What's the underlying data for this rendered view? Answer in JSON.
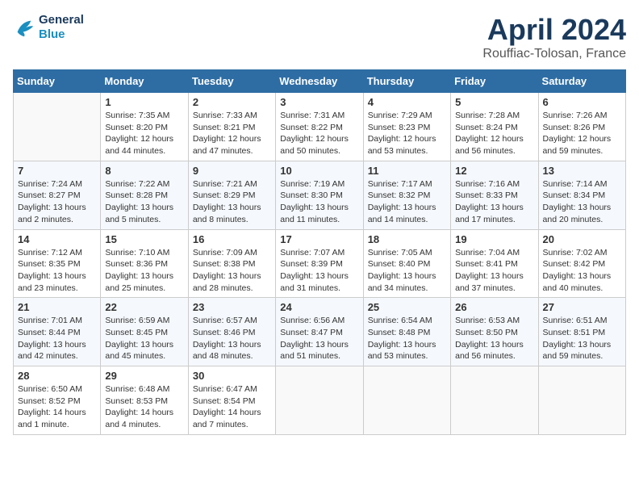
{
  "logo": {
    "line1": "General",
    "line2": "Blue"
  },
  "title": "April 2024",
  "subtitle": "Rouffiac-Tolosan, France",
  "headers": [
    "Sunday",
    "Monday",
    "Tuesday",
    "Wednesday",
    "Thursday",
    "Friday",
    "Saturday"
  ],
  "weeks": [
    [
      {
        "day": "",
        "info": ""
      },
      {
        "day": "1",
        "info": "Sunrise: 7:35 AM\nSunset: 8:20 PM\nDaylight: 12 hours\nand 44 minutes."
      },
      {
        "day": "2",
        "info": "Sunrise: 7:33 AM\nSunset: 8:21 PM\nDaylight: 12 hours\nand 47 minutes."
      },
      {
        "day": "3",
        "info": "Sunrise: 7:31 AM\nSunset: 8:22 PM\nDaylight: 12 hours\nand 50 minutes."
      },
      {
        "day": "4",
        "info": "Sunrise: 7:29 AM\nSunset: 8:23 PM\nDaylight: 12 hours\nand 53 minutes."
      },
      {
        "day": "5",
        "info": "Sunrise: 7:28 AM\nSunset: 8:24 PM\nDaylight: 12 hours\nand 56 minutes."
      },
      {
        "day": "6",
        "info": "Sunrise: 7:26 AM\nSunset: 8:26 PM\nDaylight: 12 hours\nand 59 minutes."
      }
    ],
    [
      {
        "day": "7",
        "info": "Sunrise: 7:24 AM\nSunset: 8:27 PM\nDaylight: 13 hours\nand 2 minutes."
      },
      {
        "day": "8",
        "info": "Sunrise: 7:22 AM\nSunset: 8:28 PM\nDaylight: 13 hours\nand 5 minutes."
      },
      {
        "day": "9",
        "info": "Sunrise: 7:21 AM\nSunset: 8:29 PM\nDaylight: 13 hours\nand 8 minutes."
      },
      {
        "day": "10",
        "info": "Sunrise: 7:19 AM\nSunset: 8:30 PM\nDaylight: 13 hours\nand 11 minutes."
      },
      {
        "day": "11",
        "info": "Sunrise: 7:17 AM\nSunset: 8:32 PM\nDaylight: 13 hours\nand 14 minutes."
      },
      {
        "day": "12",
        "info": "Sunrise: 7:16 AM\nSunset: 8:33 PM\nDaylight: 13 hours\nand 17 minutes."
      },
      {
        "day": "13",
        "info": "Sunrise: 7:14 AM\nSunset: 8:34 PM\nDaylight: 13 hours\nand 20 minutes."
      }
    ],
    [
      {
        "day": "14",
        "info": "Sunrise: 7:12 AM\nSunset: 8:35 PM\nDaylight: 13 hours\nand 23 minutes."
      },
      {
        "day": "15",
        "info": "Sunrise: 7:10 AM\nSunset: 8:36 PM\nDaylight: 13 hours\nand 25 minutes."
      },
      {
        "day": "16",
        "info": "Sunrise: 7:09 AM\nSunset: 8:38 PM\nDaylight: 13 hours\nand 28 minutes."
      },
      {
        "day": "17",
        "info": "Sunrise: 7:07 AM\nSunset: 8:39 PM\nDaylight: 13 hours\nand 31 minutes."
      },
      {
        "day": "18",
        "info": "Sunrise: 7:05 AM\nSunset: 8:40 PM\nDaylight: 13 hours\nand 34 minutes."
      },
      {
        "day": "19",
        "info": "Sunrise: 7:04 AM\nSunset: 8:41 PM\nDaylight: 13 hours\nand 37 minutes."
      },
      {
        "day": "20",
        "info": "Sunrise: 7:02 AM\nSunset: 8:42 PM\nDaylight: 13 hours\nand 40 minutes."
      }
    ],
    [
      {
        "day": "21",
        "info": "Sunrise: 7:01 AM\nSunset: 8:44 PM\nDaylight: 13 hours\nand 42 minutes."
      },
      {
        "day": "22",
        "info": "Sunrise: 6:59 AM\nSunset: 8:45 PM\nDaylight: 13 hours\nand 45 minutes."
      },
      {
        "day": "23",
        "info": "Sunrise: 6:57 AM\nSunset: 8:46 PM\nDaylight: 13 hours\nand 48 minutes."
      },
      {
        "day": "24",
        "info": "Sunrise: 6:56 AM\nSunset: 8:47 PM\nDaylight: 13 hours\nand 51 minutes."
      },
      {
        "day": "25",
        "info": "Sunrise: 6:54 AM\nSunset: 8:48 PM\nDaylight: 13 hours\nand 53 minutes."
      },
      {
        "day": "26",
        "info": "Sunrise: 6:53 AM\nSunset: 8:50 PM\nDaylight: 13 hours\nand 56 minutes."
      },
      {
        "day": "27",
        "info": "Sunrise: 6:51 AM\nSunset: 8:51 PM\nDaylight: 13 hours\nand 59 minutes."
      }
    ],
    [
      {
        "day": "28",
        "info": "Sunrise: 6:50 AM\nSunset: 8:52 PM\nDaylight: 14 hours\nand 1 minute."
      },
      {
        "day": "29",
        "info": "Sunrise: 6:48 AM\nSunset: 8:53 PM\nDaylight: 14 hours\nand 4 minutes."
      },
      {
        "day": "30",
        "info": "Sunrise: 6:47 AM\nSunset: 8:54 PM\nDaylight: 14 hours\nand 7 minutes."
      },
      {
        "day": "",
        "info": ""
      },
      {
        "day": "",
        "info": ""
      },
      {
        "day": "",
        "info": ""
      },
      {
        "day": "",
        "info": ""
      }
    ]
  ]
}
